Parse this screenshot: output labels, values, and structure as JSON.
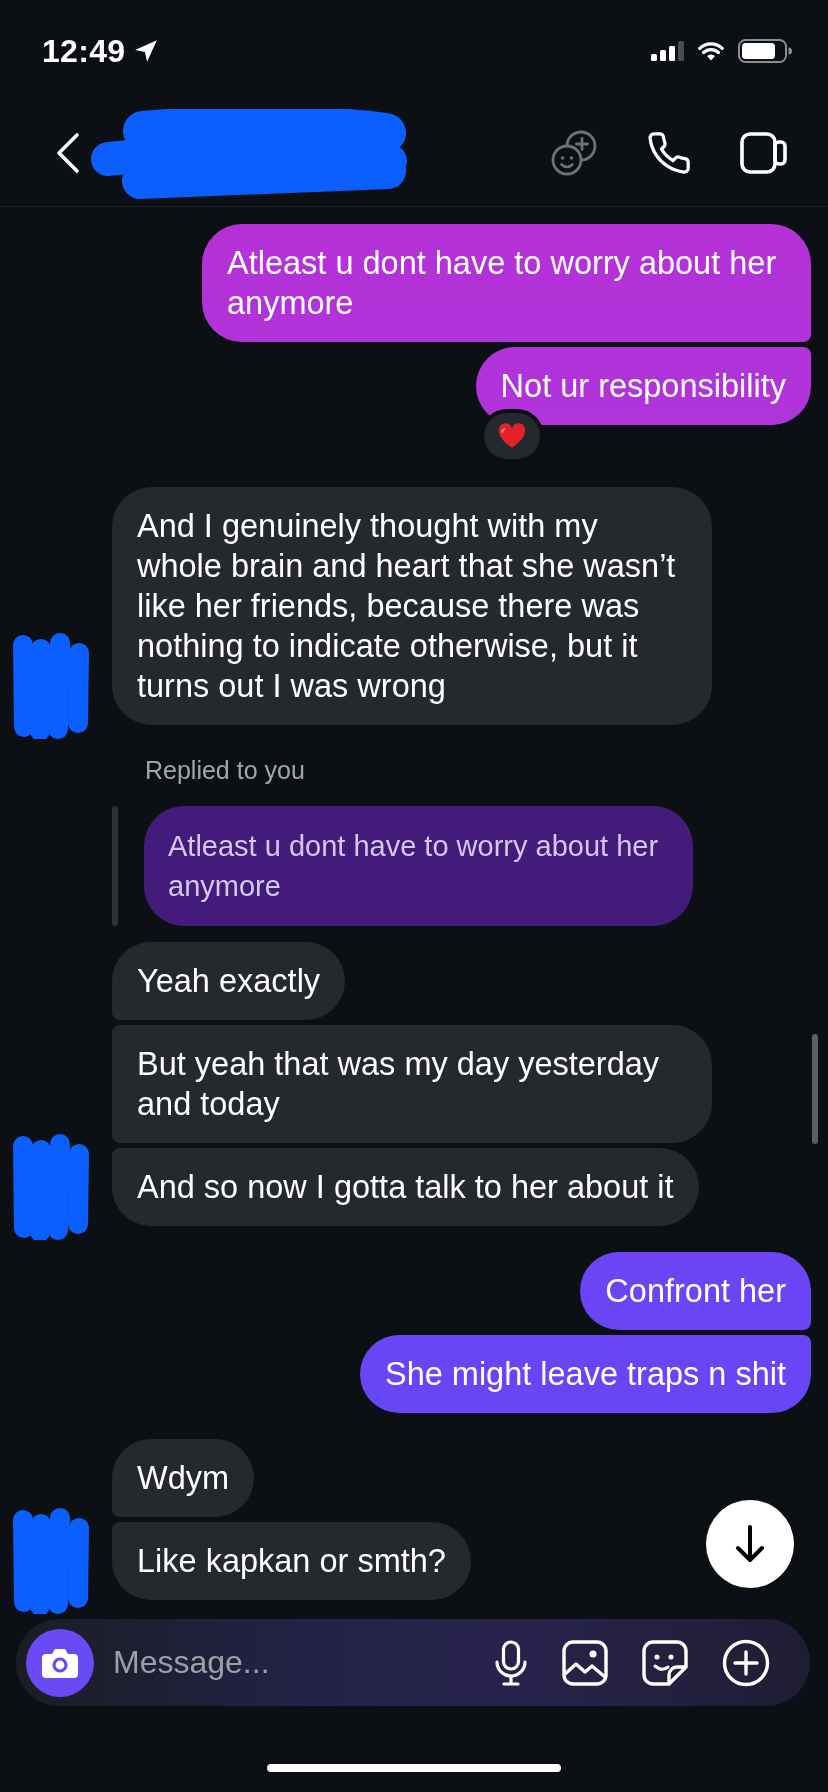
{
  "status_bar": {
    "time": "12:49"
  },
  "messages": [
    {
      "kind": "text",
      "outgoing": true,
      "text": "Atleast u dont have to worry about her anymore"
    },
    {
      "kind": "text",
      "outgoing": true,
      "text": "Not ur responsibility",
      "reaction": {
        "kind": "heart"
      }
    },
    {
      "kind": "text",
      "outgoing": false,
      "text": "And I genuinely thought with my whole brain and heart that she wasn’t like her friends, because there was nothing to indicate otherwise, but it turns out I was wrong"
    },
    {
      "kind": "reply",
      "outgoing": false,
      "label": "Replied to you",
      "text": "Atleast u dont have to worry about her anymore"
    },
    {
      "kind": "text",
      "outgoing": false,
      "text": "Yeah exactly"
    },
    {
      "kind": "text",
      "outgoing": false,
      "text": "But yeah that was my day yesterday and today"
    },
    {
      "kind": "text",
      "outgoing": false,
      "text": "And so now I gotta talk to her about it"
    },
    {
      "kind": "text",
      "outgoing": true,
      "text": "Confront her"
    },
    {
      "kind": "text",
      "outgoing": true,
      "text": "She might leave traps n shit"
    },
    {
      "kind": "text",
      "outgoing": false,
      "text": "Wdym"
    },
    {
      "kind": "text",
      "outgoing": false,
      "text": "Like kapkan or smth?"
    }
  ],
  "composer": {
    "placeholder": "Message..."
  }
}
